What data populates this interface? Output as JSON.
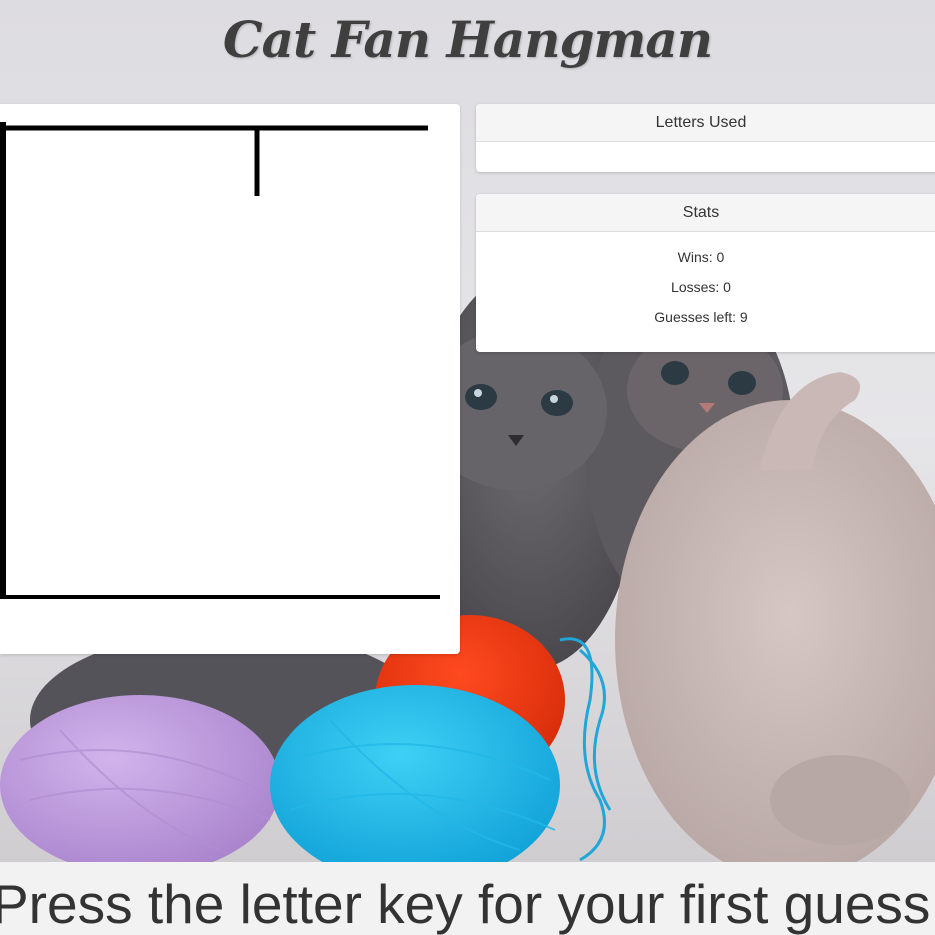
{
  "header": {
    "title": "Cat Fan Hangman"
  },
  "letters_used": {
    "heading": "Letters Used",
    "letters": ""
  },
  "stats": {
    "heading": "Stats",
    "wins": "Wins: 0",
    "losses": "Losses: 0",
    "guesses_left": "Guesses left: 9"
  },
  "footer": {
    "prompt": "Press the letter key for your first guess"
  },
  "colors": {
    "page_bg": "#e4e3e6",
    "panel_bg": "#ffffff",
    "card_header_bg": "#f5f5f5",
    "text": "#333333",
    "gallows": "#000000"
  }
}
